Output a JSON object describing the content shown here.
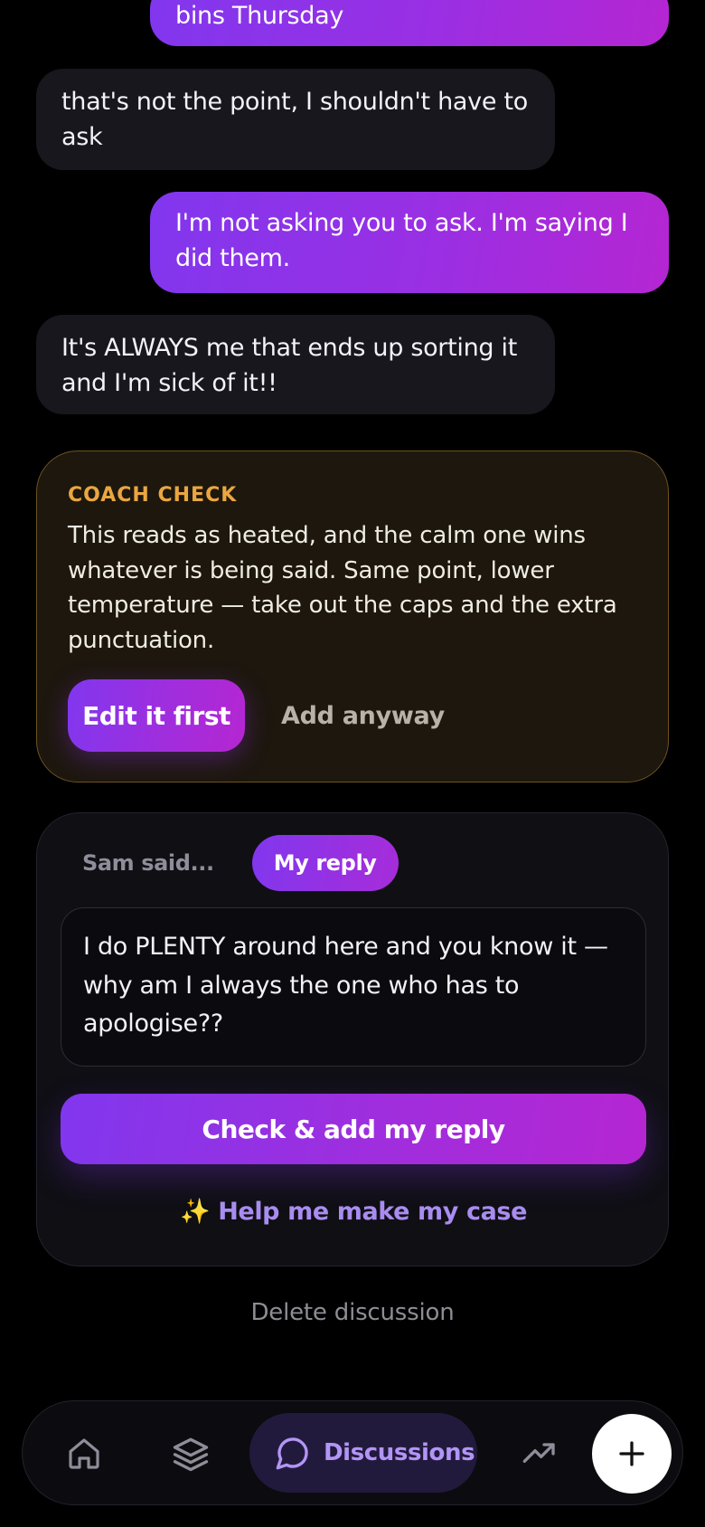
{
  "messages": [
    {
      "from": "me",
      "text": "bins Thursday"
    },
    {
      "from": "them",
      "text": "that's not the point, I shouldn't have to ask"
    },
    {
      "from": "me",
      "text": "I'm not asking you to ask. I'm saying I did them."
    },
    {
      "from": "them",
      "text": "It's ALWAYS me that ends up sorting it and I'm sick of it!!"
    }
  ],
  "coach": {
    "title": "COACH CHECK",
    "text": "This reads as heated, and the calm one wins whatever is being said. Same point, lower temperature — take out the caps and the extra punctuation.",
    "edit_label": "Edit it first",
    "anyway_label": "Add anyway"
  },
  "composer": {
    "tab_other": "Sam said...",
    "tab_mine": "My reply",
    "reply_text": "I do PLENTY around here and you know it — why am I always the one who has to apologise??",
    "check_label": "Check & add my reply",
    "help_spark": "✨",
    "help_label": "Help me make my case"
  },
  "delete_label": "Delete discussion",
  "nav": {
    "active_label": "Discussions",
    "icons": [
      "home-icon",
      "layers-icon",
      "chat-bubble-icon",
      "trending-up-icon",
      "plus-icon"
    ]
  },
  "colors": {
    "accent_start": "#8137ee",
    "accent_end": "#b526d2",
    "coach_title": "#eaa640",
    "nav_active": "#b295f5"
  }
}
